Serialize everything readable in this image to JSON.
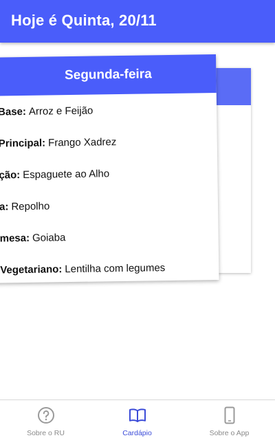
{
  "header": {
    "title": "Hoje é Quinta, 20/11"
  },
  "card": {
    "day": "Segunda-feira",
    "items": [
      {
        "label": "Base:",
        "value": "Arroz e Feijão"
      },
      {
        "label": "Principal:",
        "value": "Frango Xadrez"
      },
      {
        "label": "ção:",
        "value": "Espaguete ao Alho"
      },
      {
        "label": "a:",
        "value": "Repolho"
      },
      {
        "label": "mesa:",
        "value": "Goiaba"
      },
      {
        "label": "Vegetariano:",
        "value": "Lentilha com legumes"
      }
    ]
  },
  "nav": {
    "items": [
      {
        "label": "Sobre o RU",
        "icon": "help-circle-icon",
        "active": false
      },
      {
        "label": "Cardápio",
        "icon": "book-icon",
        "active": true
      },
      {
        "label": "Sobre o App",
        "icon": "phone-icon",
        "active": false
      }
    ]
  },
  "colors": {
    "primary": "#4a5dfa",
    "active_nav": "#3b4bd8",
    "inactive_nav": "#8a8a8a"
  }
}
